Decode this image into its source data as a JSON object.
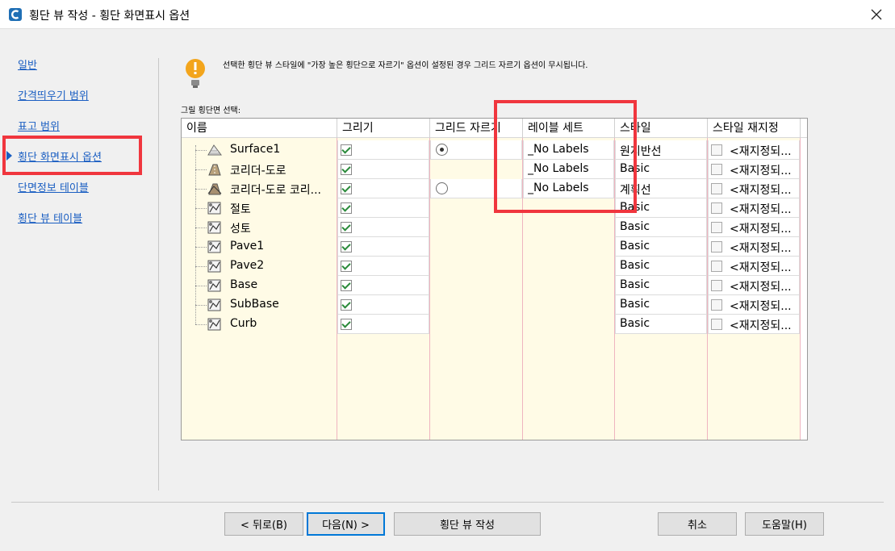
{
  "window": {
    "title": "횡단 뷰 작성 - 횡단 화면표시 옵션"
  },
  "nav": {
    "items": [
      {
        "label": "일반"
      },
      {
        "label": "간격띄우기 범위"
      },
      {
        "label": "표고 범위"
      },
      {
        "label": "횡단 화면표시 옵션"
      },
      {
        "label": "단면정보 테이블"
      },
      {
        "label": "횡단 뷰 테이블"
      }
    ],
    "active_index": 3
  },
  "info": {
    "message": "선택한 횡단 뷰 스타일에 \"가장 높은 횡단으로 자르기\" 옵션이 설정된 경우 그리드 자르기 옵션이 무시됩니다."
  },
  "grid": {
    "caption": "그릴 횡단면 선택:",
    "columns": [
      "이름",
      "그리기",
      "그리드 자르기",
      "레이블 세트",
      "스타일",
      "스타일 재지정"
    ],
    "rows": [
      {
        "name": "Surface1",
        "icon": "surface-icon",
        "draw": true,
        "clip": "selected",
        "label_set": "_No Labels",
        "style": "원지반선",
        "override": false,
        "override_text": "<재지정되..."
      },
      {
        "name": "코리더-도로",
        "icon": "corridor-icon",
        "draw": true,
        "clip": "none",
        "label_set": "_No Labels",
        "style": "Basic",
        "override": false,
        "override_text": "<재지정되..."
      },
      {
        "name": "코리더-도로 코리...",
        "icon": "corridor-surface-icon",
        "draw": true,
        "clip": "unselected",
        "label_set": "_No Labels",
        "style": "계획선",
        "override": false,
        "override_text": "<재지정되..."
      },
      {
        "name": "절토",
        "icon": "material-icon",
        "draw": true,
        "clip": "none",
        "label_set": "",
        "style": "Basic",
        "override": false,
        "override_text": "<재지정되..."
      },
      {
        "name": "성토",
        "icon": "material-icon",
        "draw": true,
        "clip": "none",
        "label_set": "",
        "style": "Basic",
        "override": false,
        "override_text": "<재지정되..."
      },
      {
        "name": "Pave1",
        "icon": "material-icon",
        "draw": true,
        "clip": "none",
        "label_set": "",
        "style": "Basic",
        "override": false,
        "override_text": "<재지정되..."
      },
      {
        "name": "Pave2",
        "icon": "material-icon",
        "draw": true,
        "clip": "none",
        "label_set": "",
        "style": "Basic",
        "override": false,
        "override_text": "<재지정되..."
      },
      {
        "name": "Base",
        "icon": "material-icon",
        "draw": true,
        "clip": "none",
        "label_set": "",
        "style": "Basic",
        "override": false,
        "override_text": "<재지정되..."
      },
      {
        "name": "SubBase",
        "icon": "material-icon",
        "draw": true,
        "clip": "none",
        "label_set": "",
        "style": "Basic",
        "override": false,
        "override_text": "<재지정되..."
      },
      {
        "name": "Curb",
        "icon": "material-icon",
        "draw": true,
        "clip": "none",
        "label_set": "",
        "style": "Basic",
        "override": false,
        "override_text": "<재지정되..."
      }
    ]
  },
  "buttons": {
    "back": "< 뒤로(B)",
    "next": "다음(N) >",
    "create": "횡단 뷰 작성",
    "cancel": "취소",
    "help": "도움말(H)"
  },
  "colors": {
    "link": "#1a5ec2",
    "highlight_box": "#f0363e",
    "grid_column_bg": "#fffbe6",
    "check_mark": "#2a8a3a"
  }
}
